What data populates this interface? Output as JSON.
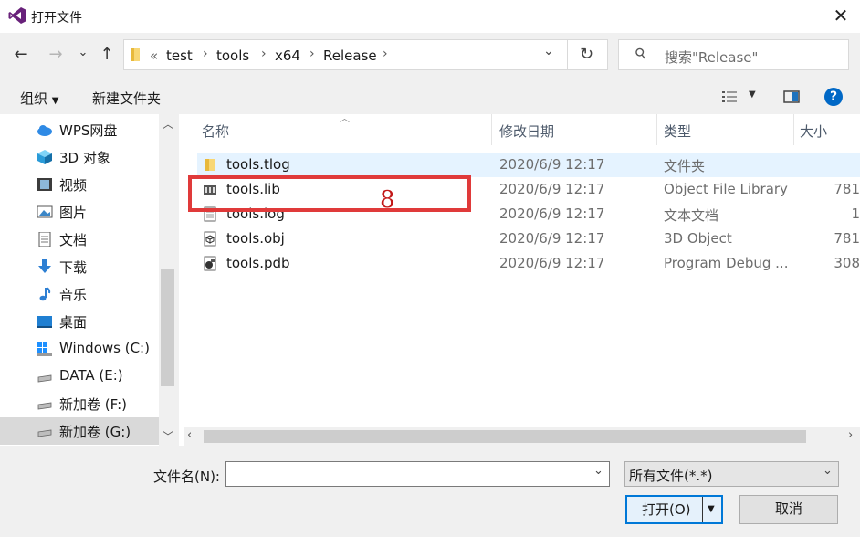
{
  "window": {
    "title": "打开文件",
    "close_glyph": "✕"
  },
  "nav": {
    "back_glyph": "←",
    "forward_glyph": "→",
    "recent_glyph": "⌄",
    "up_glyph": "↑",
    "address": {
      "chevron": "«",
      "crumbs": [
        "test",
        "tools",
        "x64",
        "Release"
      ],
      "sep": "›",
      "dropdown_glyph": "⌄"
    },
    "refresh_glyph": "↻",
    "search": {
      "placeholder": "搜索\"Release\"",
      "icon_glyph": "⚲"
    }
  },
  "toolbar": {
    "organize": "组织",
    "new_folder": "新建文件夹",
    "help_glyph": "?"
  },
  "sidebar": {
    "items": [
      {
        "label": "WPS网盘",
        "icon": "cloud-icon"
      },
      {
        "label": "3D 对象",
        "icon": "cube-icon"
      },
      {
        "label": "视频",
        "icon": "film-icon"
      },
      {
        "label": "图片",
        "icon": "picture-icon"
      },
      {
        "label": "文档",
        "icon": "document-icon"
      },
      {
        "label": "下载",
        "icon": "download-icon"
      },
      {
        "label": "音乐",
        "icon": "music-icon"
      },
      {
        "label": "桌面",
        "icon": "desktop-icon"
      },
      {
        "label": "Windows (C:)",
        "icon": "windows-drive-icon"
      },
      {
        "label": "DATA (E:)",
        "icon": "drive-icon"
      },
      {
        "label": "新加卷 (F:)",
        "icon": "drive-icon"
      },
      {
        "label": "新加卷 (G:)",
        "icon": "drive-icon",
        "selected": true
      }
    ]
  },
  "filelist": {
    "columns": {
      "name": "名称",
      "date": "修改日期",
      "type": "类型",
      "size": "大小"
    },
    "rows": [
      {
        "name": "tools.tlog",
        "date": "2020/6/9 12:17",
        "type": "文件夹",
        "size": "",
        "icon": "folder-icon",
        "highlighted": true
      },
      {
        "name": "tools.lib",
        "date": "2020/6/9 12:17",
        "type": "Object File Library",
        "size": "781",
        "icon": "library-icon"
      },
      {
        "name": "tools.log",
        "date": "2020/6/9 12:17",
        "type": "文本文档",
        "size": "1",
        "icon": "text-file-icon"
      },
      {
        "name": "tools.obj",
        "date": "2020/6/9 12:17",
        "type": "3D Object",
        "size": "781",
        "icon": "object-file-icon"
      },
      {
        "name": "tools.pdb",
        "date": "2020/6/9 12:17",
        "type": "Program Debug ...",
        "size": "308",
        "icon": "pdb-file-icon"
      }
    ]
  },
  "annotation": {
    "label": "8",
    "color": "#e03a3a"
  },
  "bottom": {
    "filename_label": "文件名(N):",
    "filename_value": "",
    "filter_value": "所有文件(*.*)",
    "open_label": "打开(O)",
    "cancel_label": "取消"
  },
  "colors": {
    "selection": "#e5f3ff",
    "selected_nav": "#cce8ff",
    "accent": "#0078d7"
  }
}
